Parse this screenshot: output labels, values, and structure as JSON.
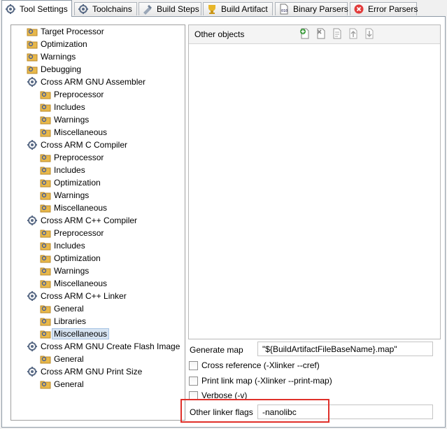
{
  "tabs": [
    {
      "label": "Tool Settings",
      "icon": "tool-settings-icon",
      "active": true
    },
    {
      "label": "Toolchains",
      "icon": "toolchains-icon"
    },
    {
      "label": "Build Steps",
      "icon": "build-steps-icon"
    },
    {
      "label": "Build Artifact",
      "icon": "build-artifact-icon"
    },
    {
      "label": "Binary Parsers",
      "icon": "binary-parsers-icon"
    },
    {
      "label": "Error Parsers",
      "icon": "error-parsers-icon"
    }
  ],
  "tree": {
    "items": [
      {
        "label": "Target Processor",
        "type": "category"
      },
      {
        "label": "Optimization",
        "type": "category"
      },
      {
        "label": "Warnings",
        "type": "category"
      },
      {
        "label": "Debugging",
        "type": "category"
      },
      {
        "label": "Cross ARM GNU Assembler",
        "type": "tool"
      },
      {
        "label": "Preprocessor",
        "type": "category"
      },
      {
        "label": "Includes",
        "type": "category"
      },
      {
        "label": "Warnings",
        "type": "category"
      },
      {
        "label": "Miscellaneous",
        "type": "category"
      },
      {
        "label": "Cross ARM C Compiler",
        "type": "tool"
      },
      {
        "label": "Preprocessor",
        "type": "category"
      },
      {
        "label": "Includes",
        "type": "category"
      },
      {
        "label": "Optimization",
        "type": "category"
      },
      {
        "label": "Warnings",
        "type": "category"
      },
      {
        "label": "Miscellaneous",
        "type": "category"
      },
      {
        "label": "Cross ARM C++ Compiler",
        "type": "tool"
      },
      {
        "label": "Preprocessor",
        "type": "category"
      },
      {
        "label": "Includes",
        "type": "category"
      },
      {
        "label": "Optimization",
        "type": "category"
      },
      {
        "label": "Warnings",
        "type": "category"
      },
      {
        "label": "Miscellaneous",
        "type": "category"
      },
      {
        "label": "Cross ARM C++ Linker",
        "type": "tool"
      },
      {
        "label": "General",
        "type": "category"
      },
      {
        "label": "Libraries",
        "type": "category"
      },
      {
        "label": "Miscellaneous",
        "type": "category",
        "selected": true
      },
      {
        "label": "Cross ARM GNU Create Flash Image",
        "type": "tool"
      },
      {
        "label": "General",
        "type": "category"
      },
      {
        "label": "Cross ARM GNU Print Size",
        "type": "tool"
      },
      {
        "label": "General",
        "type": "category"
      }
    ]
  },
  "other_objects": {
    "title": "Other objects",
    "toolbar": [
      "add-icon",
      "delete-icon",
      "edit-icon",
      "move-up-icon",
      "move-down-icon"
    ],
    "items": []
  },
  "form": {
    "generate_map_label": "Generate map",
    "generate_map_value": "\"${BuildArtifactFileBaseName}.map\"",
    "cross_reference_label": "Cross reference (-Xlinker --cref)",
    "cross_reference_checked": false,
    "print_link_map_label": "Print link map (-Xlinker --print-map)",
    "print_link_map_checked": false,
    "verbose_label": "Verbose (-v)",
    "verbose_checked": false,
    "other_linker_flags_label": "Other linker flags",
    "other_linker_flags_value": "-nanolibc"
  },
  "colors": {
    "highlight": "#e0302a",
    "selection": "#d7e4f2",
    "folder": "#e8b84a"
  }
}
